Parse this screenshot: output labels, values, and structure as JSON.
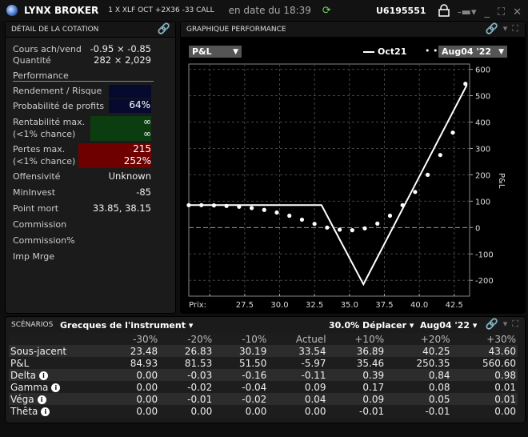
{
  "titlebar": {
    "brand": "LYNX BROKER",
    "combo": "1 X XLF OCT  +2X36  -33 CALL",
    "as_of": "en date du 18:39",
    "account": "U6195551"
  },
  "quote_panel": {
    "title": "DÉTAIL DE LA COTATION",
    "bid_ask_label": "Cours ach/vend",
    "bid_ask_value": "-0.95 × -0.85",
    "qty_label": "Quantité",
    "qty_value": "282 × 2,029",
    "perf_label": "Performance",
    "rr_label": "Rendement / Risque",
    "rr_value": "",
    "pop_label": "Probabilité de profits",
    "pop_value": "64%",
    "maxprofit_label": "Rentabilité max.",
    "maxprofit_sub": "(<1% chance)",
    "maxprofit_value": "∞",
    "maxprofit_value2": "∞",
    "maxloss_label": "Pertes max.",
    "maxloss_sub": "(<1% chance)",
    "maxloss_value": "215",
    "maxloss_value2": "252%",
    "offense_label": "Offensivité",
    "offense_value": "Unknown",
    "mininvest_label": "MinInvest",
    "mininvest_value": "-85",
    "breakeven_label": "Point mort",
    "breakeven_value": "33.85, 38.15",
    "commission_label": "Commission",
    "commission_pct_label": "Commission%",
    "margin_label": "Imp Mrge"
  },
  "chart_panel": {
    "title": "GRAPHIQUE PERFORMANCE",
    "metric_select": "P&L",
    "legend_solid": "Oct21",
    "date_select": "Aug04 '22"
  },
  "chart_data": {
    "type": "line",
    "title": "",
    "xlabel": "Prix:",
    "ylabel": "P&L",
    "xlim": [
      23.5,
      43.6
    ],
    "ylim": [
      -260,
      620
    ],
    "xticks": [
      27.5,
      30.0,
      32.5,
      35.0,
      37.5,
      40.0,
      42.5
    ],
    "xtick_labels": [
      "27.5",
      "30.0",
      "32.5",
      "35.0",
      "37.5",
      "40.0",
      "42.5"
    ],
    "yticks": [
      600,
      500,
      400,
      300,
      200,
      100,
      0,
      -100,
      -200
    ],
    "grid": true,
    "series": [
      {
        "name": "Oct21",
        "style": "solid",
        "x": [
          23.5,
          33.0,
          36.0,
          43.4
        ],
        "y": [
          85,
          85,
          -215,
          540
        ]
      },
      {
        "name": "Aug04 '22",
        "style": "dotted",
        "x": [
          23.5,
          24.4,
          25.3,
          26.2,
          27.1,
          28.0,
          28.9,
          29.8,
          30.7,
          31.6,
          32.5,
          33.4,
          34.3,
          35.2,
          36.1,
          37.0,
          37.9,
          38.8,
          39.7,
          40.6,
          41.5,
          42.4,
          43.3
        ],
        "y": [
          85,
          85,
          84,
          82,
          79,
          74,
          67,
          57,
          45,
          30,
          14,
          0,
          -8,
          -10,
          -3,
          15,
          45,
          85,
          135,
          200,
          275,
          360,
          545
        ]
      }
    ]
  },
  "scenarios": {
    "title": "SCÉNARIOS",
    "greeks_select": "Grecques de l'instrument",
    "move_select": "30.0% Déplacer",
    "date_select": "Aug04 '22",
    "columns": [
      "",
      "-30%",
      "-20%",
      "-10%",
      "Actuel",
      "+10%",
      "+20%",
      "+30%"
    ],
    "rows": [
      {
        "label": "Sous-jacent",
        "info": false,
        "values": [
          "23.48",
          "26.83",
          "30.19",
          "33.54",
          "36.89",
          "40.25",
          "43.60"
        ]
      },
      {
        "label": "P&L",
        "info": false,
        "values": [
          "84.93",
          "81.53",
          "51.50",
          "-5.97",
          "35.46",
          "250.35",
          "560.60"
        ]
      },
      {
        "label": "Delta",
        "info": true,
        "values": [
          "0.00",
          "-0.03",
          "-0.16",
          "-0.11",
          "0.39",
          "0.84",
          "0.98"
        ]
      },
      {
        "label": "Gamma",
        "info": true,
        "values": [
          "0.00",
          "-0.02",
          "-0.04",
          "0.09",
          "0.17",
          "0.08",
          "0.01"
        ]
      },
      {
        "label": "Véga",
        "info": true,
        "values": [
          "0.00",
          "-0.01",
          "-0.02",
          "0.04",
          "0.09",
          "0.05",
          "0.01"
        ]
      },
      {
        "label": "Thêta",
        "info": true,
        "values": [
          "0.00",
          "0.00",
          "0.00",
          "0.00",
          "-0.01",
          "-0.01",
          "0.00"
        ]
      }
    ]
  },
  "colors": {
    "profit_box": "#0b3d10",
    "loss_box": "#6e0000",
    "ratio_box": "#050a2e",
    "link_green": "#7bd36b"
  }
}
